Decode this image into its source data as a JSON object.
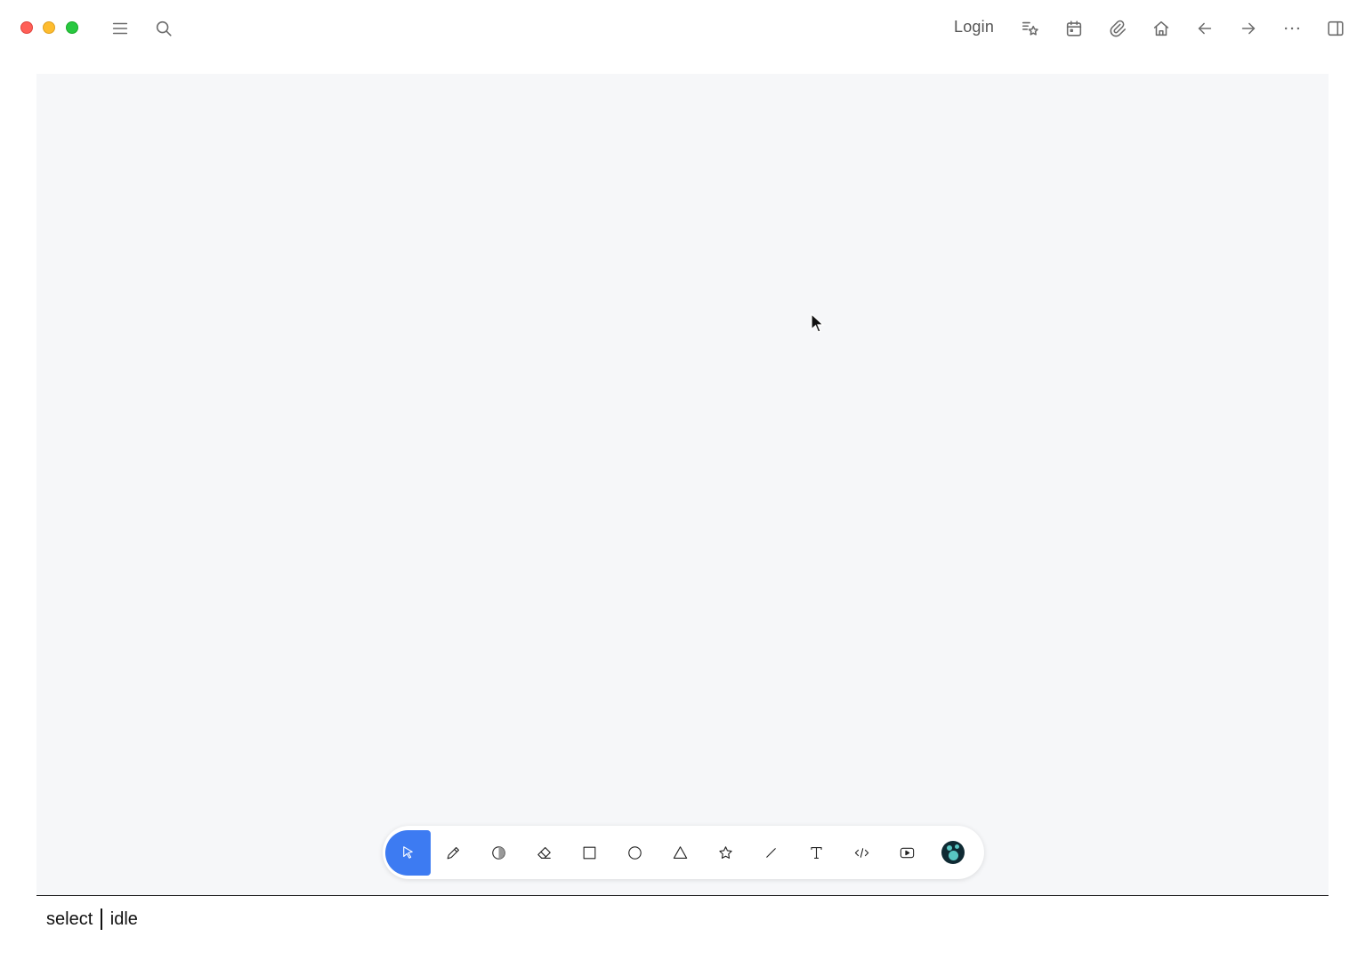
{
  "titlebar": {
    "login_label": "Login",
    "left_icons": [
      "menu-icon",
      "search-icon"
    ],
    "right_icons": [
      "starred-icon",
      "calendar-icon",
      "attachment-icon",
      "home-icon",
      "arrow-left-icon",
      "arrow-right-icon",
      "more-icon",
      "sidebar-toggle-icon"
    ]
  },
  "toolbar": {
    "tools": [
      "select",
      "pencil",
      "highlighter",
      "eraser",
      "rectangle",
      "ellipse",
      "triangle",
      "star",
      "line",
      "text",
      "embed-code",
      "youtube",
      "logseq"
    ],
    "active_tool": "select",
    "active_color": "#3d7bf2"
  },
  "status": {
    "tool": "select",
    "state": "idle"
  }
}
